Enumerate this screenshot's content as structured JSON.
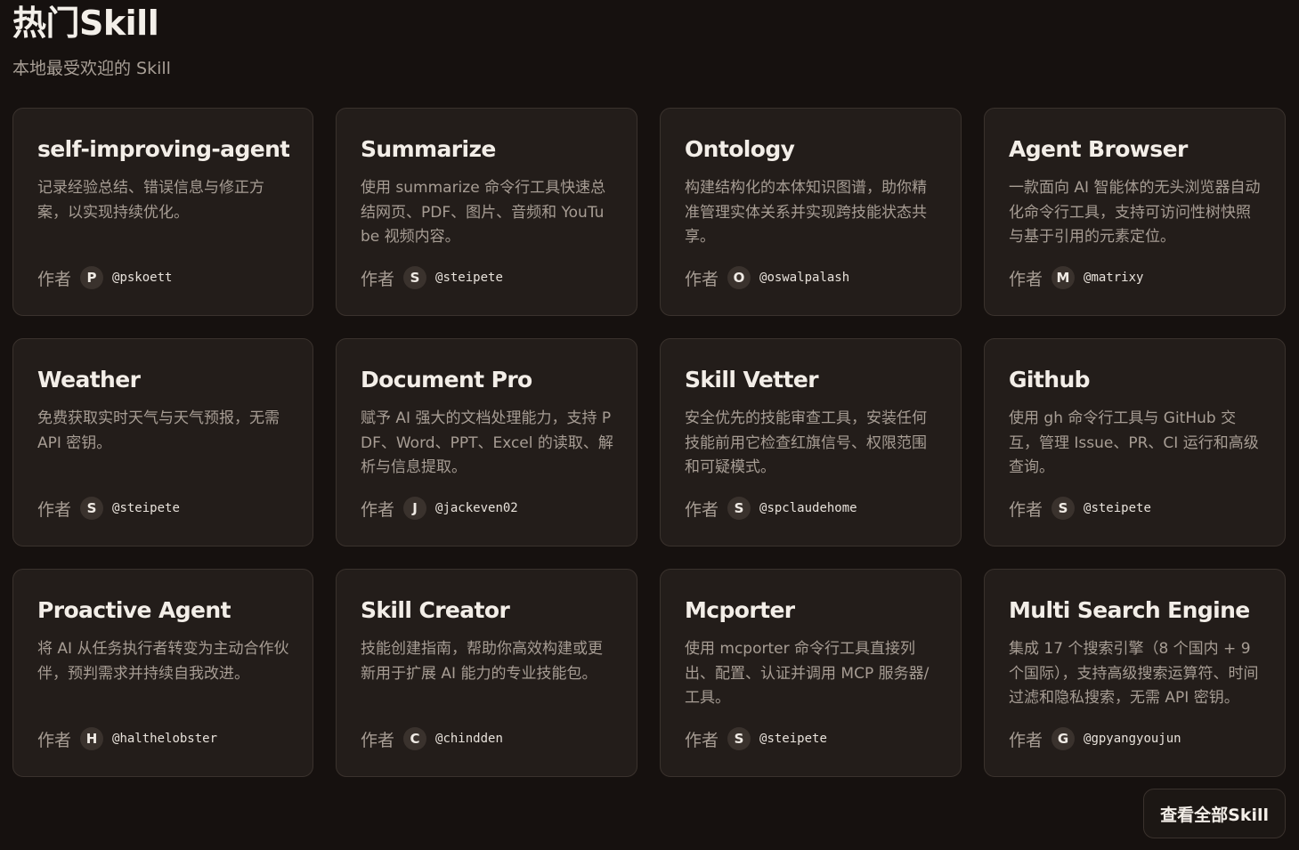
{
  "header": {
    "title": "热门Skill",
    "subtitle": "本地最受欢迎的 Skill"
  },
  "author_label": "作者",
  "cards": [
    {
      "title": "self-improving-agent",
      "description": "记录经验总结、错误信息与修正方案，以实现持续优化。",
      "avatar": "P",
      "handle": "@pskoett"
    },
    {
      "title": "Summarize",
      "description": "使用 summarize 命令行工具快速总结网页、PDF、图片、音频和 YouTube 视频内容。",
      "avatar": "S",
      "handle": "@steipete"
    },
    {
      "title": "Ontology",
      "description": "构建结构化的本体知识图谱，助你精准管理实体关系并实现跨技能状态共享。",
      "avatar": "O",
      "handle": "@oswalpalash"
    },
    {
      "title": "Agent Browser",
      "description": "一款面向 AI 智能体的无头浏览器自动化命令行工具，支持可访问性树快照与基于引用的元素定位。",
      "avatar": "M",
      "handle": "@matrixy"
    },
    {
      "title": "Weather",
      "description": "免费获取实时天气与天气预报，无需 API 密钥。",
      "avatar": "S",
      "handle": "@steipete"
    },
    {
      "title": "Document Pro",
      "description": "赋予 AI 强大的文档处理能力，支持 PDF、Word、PPT、Excel 的读取、解析与信息提取。",
      "avatar": "J",
      "handle": "@jackeven02"
    },
    {
      "title": "Skill Vetter",
      "description": "安全优先的技能审查工具，安装任何技能前用它检查红旗信号、权限范围和可疑模式。",
      "avatar": "S",
      "handle": "@spclaudehome"
    },
    {
      "title": "Github",
      "description": "使用 gh 命令行工具与 GitHub 交互，管理 Issue、PR、CI 运行和高级查询。",
      "avatar": "S",
      "handle": "@steipete"
    },
    {
      "title": "Proactive Agent",
      "description": "将 AI 从任务执行者转变为主动合作伙伴，预判需求并持续自我改进。",
      "avatar": "H",
      "handle": "@halthelobster"
    },
    {
      "title": "Skill Creator",
      "description": "技能创建指南，帮助你高效构建或更新用于扩展 AI 能力的专业技能包。",
      "avatar": "C",
      "handle": "@chindden"
    },
    {
      "title": "Mcporter",
      "description": "使用 mcporter 命令行工具直接列出、配置、认证并调用 MCP 服务器/工具。",
      "avatar": "S",
      "handle": "@steipete"
    },
    {
      "title": "Multi Search Engine",
      "description": "集成 17 个搜索引擎（8 个国内 + 9 个国际），支持高级搜索运算符、时间过滤和隐私搜索，无需 API 密钥。",
      "avatar": "G",
      "handle": "@gpyangyoujun"
    }
  ],
  "footer": {
    "view_all_label": "查看全部Skill"
  }
}
